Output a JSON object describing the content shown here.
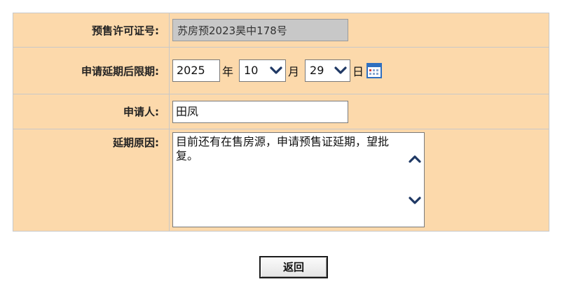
{
  "form": {
    "presale_permit": {
      "label": "预售许可证号:",
      "value": "苏房预2023昊中178号"
    },
    "extension_deadline": {
      "label": "申请延期后限期:",
      "year": "2025",
      "year_unit": "年",
      "month": "10",
      "month_unit": "月",
      "day": "29",
      "day_unit": "日"
    },
    "applicant": {
      "label": "申请人:",
      "value": "田凤"
    },
    "reason": {
      "label": "延期原因:",
      "value": "目前还有在售房源，申请预售证延期，望批复。"
    }
  },
  "actions": {
    "back_label": "返回"
  },
  "colors": {
    "row_background": "#fcd9ab",
    "readonly_background": "#c8c8c8",
    "border": "#c8c8c8",
    "chevron": "#1f3864",
    "calendar_accent": "#2f6fbf"
  },
  "icons": {
    "dropdown": "chevron-down-icon",
    "calendar": "calendar-icon",
    "scroll_up": "chevron-up-icon",
    "scroll_down": "chevron-down-icon"
  }
}
